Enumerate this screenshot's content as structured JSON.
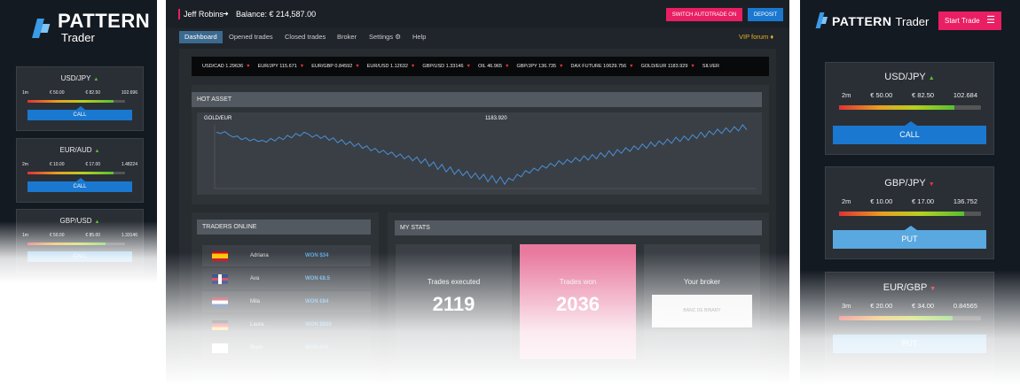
{
  "left": {
    "logo": {
      "main": "PATTERN",
      "sub": "Trader"
    },
    "assets": [
      {
        "name": "USD/JPY",
        "dir": "▲",
        "dir_color": "#58c030",
        "row": [
          "1m",
          "€ 50.00",
          "€ 82.50",
          "102.696"
        ],
        "level": 0.73,
        "action": "CALL",
        "kind": "call"
      },
      {
        "name": "EUR/AUD",
        "dir": "▲",
        "dir_color": "#58c030",
        "row": [
          "2m",
          "€ 10.00",
          "€ 17.00",
          "1.48224"
        ],
        "level": 0.78,
        "action": "CALL",
        "kind": "call"
      },
      {
        "name": "GBP/USD",
        "dir": "▲",
        "dir_color": "#58c030",
        "row": [
          "1m",
          "€ 50.00",
          "€ 85.00",
          "1.33146"
        ],
        "level": 0.73,
        "action": "CALL",
        "kind": "light"
      }
    ]
  },
  "main": {
    "user_name": "Jeff Robins",
    "balance": "Balance: € 214,587.00",
    "autotrade_button": "SWITCH AUTOTRADE ON",
    "deposit_button": "DEPOSIT",
    "tabs": [
      "Dashboard",
      "Opened trades",
      "Closed trades",
      "Broker",
      "Settings",
      "Help"
    ],
    "vip_link": "VIP forum",
    "ticker": [
      {
        "label": "USD/CAD 1.29636",
        "dir": "▼",
        "color": "#e53935"
      },
      {
        "label": "EUR/JPY 115.671",
        "dir": "▼",
        "color": "#e53935"
      },
      {
        "label": "EUR/GBP 0.84592",
        "dir": "▼",
        "color": "#e53935"
      },
      {
        "label": "EUR/USD 1.12632",
        "dir": "▼",
        "color": "#e53935"
      },
      {
        "label": "GBP/USD 1.33146",
        "dir": "▼",
        "color": "#e53935"
      },
      {
        "label": "OIL 46.965",
        "dir": "▼",
        "color": "#e53935"
      },
      {
        "label": "GBP/JPY 136.735",
        "dir": "▼",
        "color": "#e53935"
      },
      {
        "label": "DAX FUTURE 10629.756",
        "dir": "▼",
        "color": "#e53935"
      },
      {
        "label": "GOLD/EUR 1183.929",
        "dir": "▼",
        "color": "#e53935"
      },
      {
        "label": "SILVER",
        "dir": "",
        "color": "#e53935"
      }
    ],
    "hot_asset": {
      "title": "HOT ASSET",
      "symbol": "GOLD/EUR",
      "price": "1183.920"
    },
    "traders": {
      "title": "TRADERS ONLINE",
      "rows": [
        {
          "name": "Adriana",
          "result": "WON $34",
          "flag": "spain"
        },
        {
          "name": "Ava",
          "result": "WON €8.5",
          "flag": "uk"
        },
        {
          "name": "Mila",
          "result": "WON €84",
          "flag": "netherlands"
        },
        {
          "name": "Laura",
          "result": "WON $850",
          "flag": "germany"
        },
        {
          "name": "Bram",
          "result": "WON €45",
          "flag": "england"
        }
      ]
    },
    "stats": {
      "title": "MY STATS",
      "executed_label": "Trades executed",
      "executed_value": "2119",
      "won_label": "Trades won",
      "won_value": "2036",
      "broker_label": "Your broker",
      "broker_name": "BANC DE BINARY"
    }
  },
  "right": {
    "logo": {
      "main": "PATTERN",
      "sub": "Trader"
    },
    "start_button": "Start Trade",
    "assets": [
      {
        "name": "USD/JPY",
        "dir": "▲",
        "dir_color": "#58c030",
        "row": [
          "2m",
          "€ 50.00",
          "€ 82.50",
          "102.684"
        ],
        "level": 0.81,
        "action": "CALL",
        "kind": "call"
      },
      {
        "name": "GBP/JPY",
        "dir": "▼",
        "dir_color": "#e53935",
        "row": [
          "2m",
          "€ 10.00",
          "€ 17.00",
          "136.752"
        ],
        "level": 0.88,
        "action": "PUT",
        "kind": "put"
      },
      {
        "name": "EUR/GBP",
        "dir": "▼",
        "dir_color": "#e53935",
        "row": [
          "3m",
          "€ 20.00",
          "€ 34.00",
          "0.84565"
        ],
        "level": 0.8,
        "action": "PUT",
        "kind": "put"
      }
    ]
  },
  "chart_data": {
    "type": "line",
    "series": [
      {
        "name": "GOLD/EUR",
        "values": [
          88,
          86,
          89,
          84,
          80,
          82,
          76,
          79,
          74,
          77,
          73,
          75,
          72,
          78,
          74,
          80,
          76,
          83,
          79,
          86,
          82,
          88,
          85,
          80,
          84,
          78,
          82,
          75,
          79,
          71,
          76,
          68,
          73,
          65,
          70,
          62,
          66,
          58,
          62,
          55,
          59,
          52,
          56,
          48,
          53,
          45,
          50,
          42,
          48,
          38,
          45,
          33,
          40,
          28,
          36,
          24,
          32,
          20,
          28,
          18,
          25,
          14,
          22,
          12,
          20,
          8,
          18,
          6,
          16,
          4,
          14,
          10,
          20,
          16,
          26,
          22,
          30,
          26,
          34,
          30,
          38,
          33,
          42,
          36,
          44,
          39,
          47,
          41,
          50,
          43,
          52,
          45,
          55,
          48,
          58,
          50,
          60,
          54,
          63,
          57,
          66,
          60,
          69,
          62,
          72,
          65,
          74,
          68,
          77,
          70,
          80,
          73,
          82,
          75,
          84,
          78,
          88,
          80,
          90,
          84,
          93,
          86,
          95,
          88,
          97,
          90,
          100,
          92
        ]
      }
    ]
  }
}
